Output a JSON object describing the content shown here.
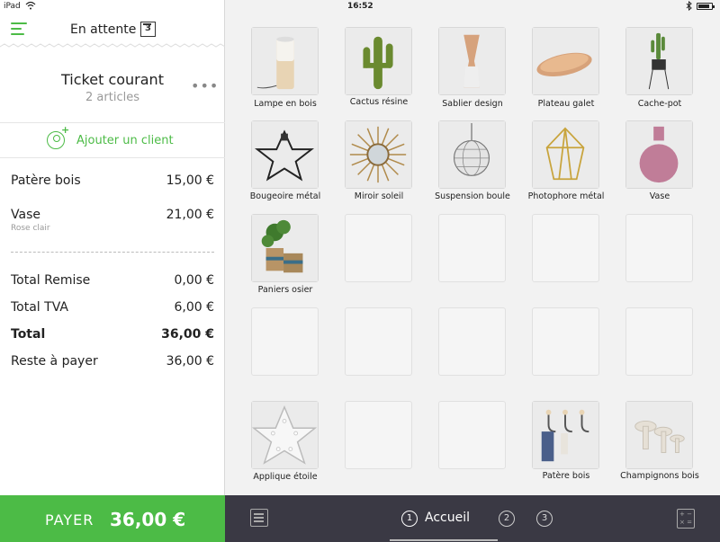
{
  "status_bar": {
    "carrier": "iPad",
    "time": "16:52"
  },
  "header": {
    "pending_label": "En attente",
    "pending_count": "3"
  },
  "ticket": {
    "title": "Ticket courant",
    "count": "2 articles",
    "more": "•••"
  },
  "client": {
    "label": "Ajouter un client"
  },
  "lines": [
    {
      "name": "Patère bois",
      "price": "15,00 €",
      "note": ""
    },
    {
      "name": "Vase",
      "price": "21,00 €",
      "note": "Rose clair"
    }
  ],
  "totals": [
    {
      "label": "Total Remise",
      "value": "0,00 €"
    },
    {
      "label": "Total TVA",
      "value": "6,00 €"
    },
    {
      "label": "Total",
      "value": "36,00 €"
    },
    {
      "label": "Reste à payer",
      "value": "36,00 €"
    }
  ],
  "pay": {
    "label": "PAYER",
    "amount": "36,00 €"
  },
  "products": [
    {
      "name": "Lampe en bois",
      "icon": "lamp-icon"
    },
    {
      "name": "Cactus résine",
      "icon": "cactus-icon"
    },
    {
      "name": "Sablier design",
      "icon": "hourglass-icon"
    },
    {
      "name": "Plateau galet",
      "icon": "tray-icon"
    },
    {
      "name": "Cache-pot",
      "icon": "plant-pot-icon"
    },
    {
      "name": "Bougeoire métal",
      "icon": "candle-holder-icon"
    },
    {
      "name": "Miroir soleil",
      "icon": "sun-mirror-icon"
    },
    {
      "name": "Suspension boule",
      "icon": "pendant-light-icon"
    },
    {
      "name": "Photophore métal",
      "icon": "lantern-icon"
    },
    {
      "name": "Vase",
      "icon": "vase-icon"
    },
    {
      "name": "Paniers osier",
      "icon": "baskets-icon"
    },
    {
      "name": "Applique étoile",
      "icon": "star-lamp-icon"
    },
    {
      "name": "Patère bois",
      "icon": "coat-hooks-icon"
    },
    {
      "name": "Champignons bois",
      "icon": "mushrooms-icon"
    }
  ],
  "bottom_bar": {
    "list_icon": "list-icon",
    "pages": [
      "1",
      "2",
      "3"
    ],
    "active_page_label": "Accueil",
    "calculator_icon": "calculator-icon"
  },
  "colors": {
    "accent": "#4cbb46",
    "bottom_bar": "#3a3944",
    "grid_bg": "#f2f2f2"
  }
}
